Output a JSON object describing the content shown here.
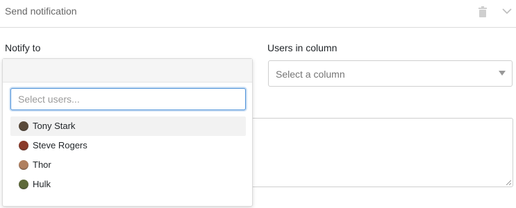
{
  "header": {
    "title": "Send notification",
    "delete_icon": "trash-icon",
    "collapse_icon": "chevron-down-icon"
  },
  "notify": {
    "label": "Notify to",
    "search_placeholder": "Select users...",
    "users": [
      {
        "name": "Tony Stark",
        "avatar_color": "#5a4a3a",
        "highlighted": true
      },
      {
        "name": "Steve Rogers",
        "avatar_color": "#8a3a2a",
        "highlighted": false
      },
      {
        "name": "Thor",
        "avatar_color": "#b08060",
        "highlighted": false
      },
      {
        "name": "Hulk",
        "avatar_color": "#5e6a3a",
        "highlighted": false
      }
    ]
  },
  "users_in_column": {
    "label": "Users in column",
    "placeholder": "Select a column"
  },
  "colors": {
    "focus_border": "#4a90d9",
    "highlight_bg": "#f2f2f2"
  }
}
